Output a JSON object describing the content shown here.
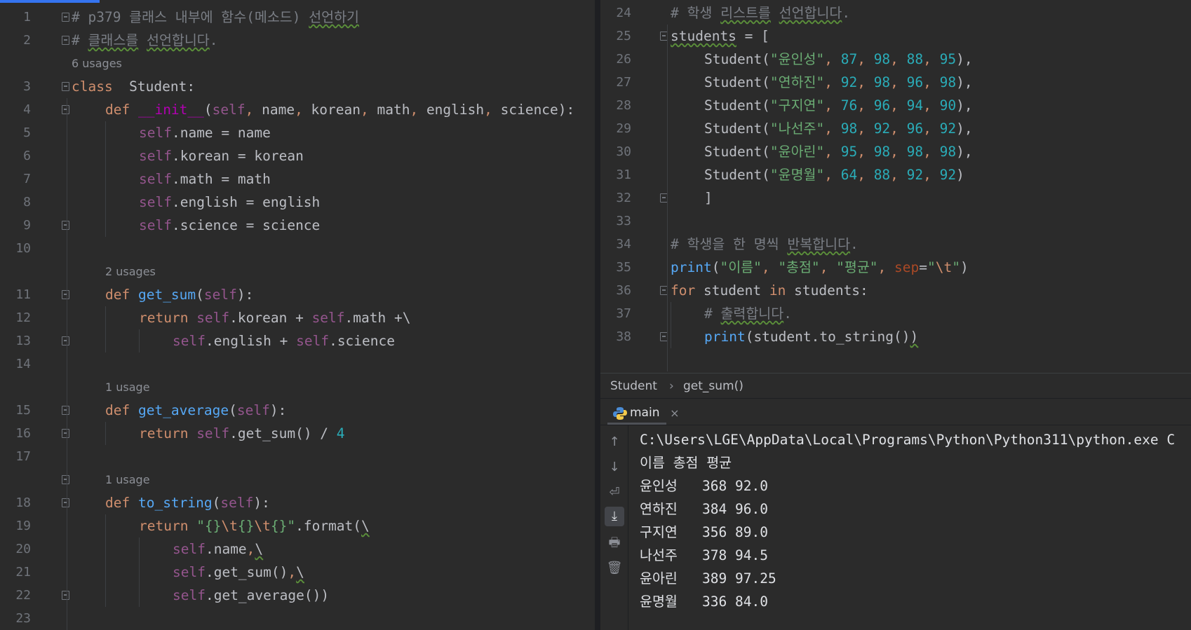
{
  "left_editor": {
    "lines": [
      {
        "n": "1",
        "indent": 0,
        "parts": [
          [
            "cm",
            "# p379 "
          ],
          [
            "cm",
            "클래스 내부에 함수(메소드) "
          ],
          [
            "cm ul",
            "선언하기"
          ]
        ]
      },
      {
        "n": "2",
        "indent": 0,
        "parts": [
          [
            "cm",
            "# "
          ],
          [
            "cm ul",
            "클래스를"
          ],
          [
            "cm",
            " "
          ],
          [
            "cm ul",
            "선언합니다"
          ],
          [
            "cm",
            "."
          ]
        ]
      },
      {
        "usage": "6 usages",
        "indent": 0
      },
      {
        "n": "3",
        "indent": 0,
        "parts": [
          [
            "kw",
            "class"
          ],
          [
            "",
            "  Student:"
          ]
        ]
      },
      {
        "n": "4",
        "indent": 1,
        "parts": [
          [
            "kw",
            "def "
          ],
          [
            "magic",
            "__init__"
          ],
          [
            "",
            "("
          ],
          [
            "self",
            "self"
          ],
          [
            "kw",
            ", "
          ],
          [
            "",
            "name"
          ],
          [
            "kw",
            ", "
          ],
          [
            "",
            "korean"
          ],
          [
            "kw",
            ", "
          ],
          [
            "",
            "math"
          ],
          [
            "kw",
            ", "
          ],
          [
            "",
            "english"
          ],
          [
            "kw",
            ", "
          ],
          [
            "",
            "science):"
          ]
        ]
      },
      {
        "n": "5",
        "indent": 2,
        "parts": [
          [
            "self",
            "self"
          ],
          [
            "",
            ".name = name"
          ]
        ]
      },
      {
        "n": "6",
        "indent": 2,
        "parts": [
          [
            "self",
            "self"
          ],
          [
            "",
            ".korean = korean"
          ]
        ]
      },
      {
        "n": "7",
        "indent": 2,
        "parts": [
          [
            "self",
            "self"
          ],
          [
            "",
            ".math = math"
          ]
        ]
      },
      {
        "n": "8",
        "indent": 2,
        "parts": [
          [
            "self",
            "self"
          ],
          [
            "",
            ".english = english"
          ]
        ]
      },
      {
        "n": "9",
        "indent": 2,
        "parts": [
          [
            "self",
            "self"
          ],
          [
            "",
            ".science = science"
          ]
        ]
      },
      {
        "n": "10",
        "indent": 0,
        "parts": []
      },
      {
        "usage": "2 usages",
        "indent": 1
      },
      {
        "n": "11",
        "indent": 1,
        "parts": [
          [
            "kw",
            "def "
          ],
          [
            "def",
            "get_sum"
          ],
          [
            "",
            "("
          ],
          [
            "self",
            "self"
          ],
          [
            "",
            "):"
          ]
        ]
      },
      {
        "n": "12",
        "indent": 2,
        "parts": [
          [
            "kw",
            "return "
          ],
          [
            "self",
            "self"
          ],
          [
            "",
            ".korean + "
          ],
          [
            "self",
            "self"
          ],
          [
            "",
            ".math +\\"
          ]
        ]
      },
      {
        "n": "13",
        "indent": 3,
        "parts": [
          [
            "self",
            "self"
          ],
          [
            "",
            ".english + "
          ],
          [
            "self",
            "self"
          ],
          [
            "",
            ".science"
          ]
        ]
      },
      {
        "n": "14",
        "indent": 0,
        "parts": []
      },
      {
        "usage": "1 usage",
        "indent": 1
      },
      {
        "n": "15",
        "indent": 1,
        "parts": [
          [
            "kw",
            "def "
          ],
          [
            "def",
            "get_average"
          ],
          [
            "",
            "("
          ],
          [
            "self",
            "self"
          ],
          [
            "",
            "):"
          ]
        ]
      },
      {
        "n": "16",
        "indent": 2,
        "parts": [
          [
            "kw",
            "return "
          ],
          [
            "self",
            "self"
          ],
          [
            "",
            ".get_sum() / "
          ],
          [
            "num",
            "4"
          ]
        ]
      },
      {
        "n": "17",
        "indent": 0,
        "parts": []
      },
      {
        "usage": "1 usage",
        "indent": 1
      },
      {
        "n": "18",
        "indent": 1,
        "parts": [
          [
            "kw",
            "def "
          ],
          [
            "def",
            "to_string"
          ],
          [
            "",
            "("
          ],
          [
            "self",
            "self"
          ],
          [
            "",
            "):"
          ]
        ]
      },
      {
        "n": "19",
        "indent": 2,
        "parts": [
          [
            "kw",
            "return "
          ],
          [
            "str",
            "\"{}"
          ],
          [
            "esc",
            "\\t"
          ],
          [
            "str",
            "{}"
          ],
          [
            "esc",
            "\\t"
          ],
          [
            "str",
            "{}\""
          ],
          [
            "",
            ".format("
          ],
          [
            "ul",
            "\\"
          ]
        ]
      },
      {
        "n": "20",
        "indent": 3,
        "parts": [
          [
            "self",
            "self"
          ],
          [
            "",
            ".name"
          ],
          [
            "kw",
            ","
          ],
          [
            "ul",
            "\\"
          ]
        ]
      },
      {
        "n": "21",
        "indent": 3,
        "parts": [
          [
            "self",
            "self"
          ],
          [
            "",
            ".get_sum()"
          ],
          [
            "kw",
            ","
          ],
          [
            "ul",
            "\\"
          ]
        ]
      },
      {
        "n": "22",
        "indent": 3,
        "parts": [
          [
            "self",
            "self"
          ],
          [
            "",
            ".get_average())"
          ]
        ]
      },
      {
        "n": "23",
        "indent": 0,
        "parts": []
      }
    ]
  },
  "right_editor": {
    "lines": [
      {
        "n": "24",
        "indent": 0,
        "parts": [
          [
            "cm",
            "# 학생 "
          ],
          [
            "cm ul",
            "리스트를"
          ],
          [
            "cm",
            " "
          ],
          [
            "cm ul",
            "선언합니다"
          ],
          [
            "cm",
            "."
          ]
        ]
      },
      {
        "n": "25",
        "indent": 0,
        "parts": [
          [
            "ul",
            "students"
          ],
          [
            "",
            " = ["
          ]
        ]
      },
      {
        "n": "26",
        "indent": 1,
        "parts": [
          [
            "",
            "Student("
          ],
          [
            "str",
            "\"윤인성\""
          ],
          [
            "kw",
            ", "
          ],
          [
            "num",
            "87"
          ],
          [
            "kw",
            ", "
          ],
          [
            "num",
            "98"
          ],
          [
            "kw",
            ", "
          ],
          [
            "num",
            "88"
          ],
          [
            "kw",
            ", "
          ],
          [
            "num",
            "95"
          ],
          [
            "",
            "),"
          ]
        ]
      },
      {
        "n": "27",
        "indent": 1,
        "parts": [
          [
            "",
            "Student("
          ],
          [
            "str",
            "\"연하진\""
          ],
          [
            "kw",
            ", "
          ],
          [
            "num",
            "92"
          ],
          [
            "kw",
            ", "
          ],
          [
            "num",
            "98"
          ],
          [
            "kw",
            ", "
          ],
          [
            "num",
            "96"
          ],
          [
            "kw",
            ", "
          ],
          [
            "num",
            "98"
          ],
          [
            "",
            "),"
          ]
        ]
      },
      {
        "n": "28",
        "indent": 1,
        "parts": [
          [
            "",
            "Student("
          ],
          [
            "str",
            "\"구지연\""
          ],
          [
            "kw",
            ", "
          ],
          [
            "num",
            "76"
          ],
          [
            "kw",
            ", "
          ],
          [
            "num",
            "96"
          ],
          [
            "kw",
            ", "
          ],
          [
            "num",
            "94"
          ],
          [
            "kw",
            ", "
          ],
          [
            "num",
            "90"
          ],
          [
            "",
            "),"
          ]
        ]
      },
      {
        "n": "29",
        "indent": 1,
        "parts": [
          [
            "",
            "Student("
          ],
          [
            "str",
            "\"나선주\""
          ],
          [
            "kw",
            ", "
          ],
          [
            "num",
            "98"
          ],
          [
            "kw",
            ", "
          ],
          [
            "num",
            "92"
          ],
          [
            "kw",
            ", "
          ],
          [
            "num",
            "96"
          ],
          [
            "kw",
            ", "
          ],
          [
            "num",
            "92"
          ],
          [
            "",
            "),"
          ]
        ]
      },
      {
        "n": "30",
        "indent": 1,
        "parts": [
          [
            "",
            "Student("
          ],
          [
            "str",
            "\"윤아린\""
          ],
          [
            "kw",
            ", "
          ],
          [
            "num",
            "95"
          ],
          [
            "kw",
            ", "
          ],
          [
            "num",
            "98"
          ],
          [
            "kw",
            ", "
          ],
          [
            "num",
            "98"
          ],
          [
            "kw",
            ", "
          ],
          [
            "num",
            "98"
          ],
          [
            "",
            "),"
          ]
        ]
      },
      {
        "n": "31",
        "indent": 1,
        "parts": [
          [
            "",
            "Student("
          ],
          [
            "str",
            "\"윤명월\""
          ],
          [
            "kw",
            ", "
          ],
          [
            "num",
            "64"
          ],
          [
            "kw",
            ", "
          ],
          [
            "num",
            "88"
          ],
          [
            "kw",
            ", "
          ],
          [
            "num",
            "92"
          ],
          [
            "kw",
            ", "
          ],
          [
            "num",
            "92"
          ],
          [
            "",
            ")"
          ]
        ]
      },
      {
        "n": "32",
        "indent": 1,
        "parts": [
          [
            "",
            "]"
          ]
        ]
      },
      {
        "n": "33",
        "indent": 0,
        "parts": []
      },
      {
        "n": "34",
        "indent": 0,
        "parts": [
          [
            "cm",
            "# 학생을 한 명씩 "
          ],
          [
            "cm ul",
            "반복합니다"
          ],
          [
            "cm",
            "."
          ]
        ]
      },
      {
        "n": "35",
        "indent": 0,
        "parts": [
          [
            "fn",
            "print"
          ],
          [
            "",
            "("
          ],
          [
            "str",
            "\"이름\""
          ],
          [
            "kw",
            ", "
          ],
          [
            "str",
            "\"총점\""
          ],
          [
            "kw",
            ", "
          ],
          [
            "str",
            "\"평균\""
          ],
          [
            "kw",
            ", "
          ],
          [
            "param",
            "sep"
          ],
          [
            "",
            "="
          ],
          [
            "str",
            "\""
          ],
          [
            "esc",
            "\\t"
          ],
          [
            "str",
            "\""
          ],
          [
            "",
            ")"
          ]
        ]
      },
      {
        "n": "36",
        "indent": 0,
        "parts": [
          [
            "kw",
            "for "
          ],
          [
            "",
            "student "
          ],
          [
            "kw",
            "in "
          ],
          [
            "",
            "students:"
          ]
        ]
      },
      {
        "n": "37",
        "indent": 1,
        "parts": [
          [
            "cm",
            "# "
          ],
          [
            "cm ul",
            "출력합니다"
          ],
          [
            "cm",
            "."
          ]
        ]
      },
      {
        "n": "38",
        "indent": 1,
        "parts": [
          [
            "fn",
            "print"
          ],
          [
            "",
            "(student.to_string()"
          ],
          [
            "ul",
            ")"
          ]
        ]
      }
    ]
  },
  "breadcrumb": {
    "item1": "Student",
    "sep": "›",
    "item2": "get_sum()"
  },
  "run_panel": {
    "tab_label": "main",
    "close": "×",
    "toolbar": [
      "↑",
      "↓",
      "⏎",
      "⤓",
      "🖶",
      "🗑"
    ],
    "console": [
      "C:\\Users\\LGE\\AppData\\Local\\Programs\\Python\\Python311\\python.exe C",
      "이름 총점 평균",
      "윤인성   368 92.0",
      "연하진   384 96.0",
      "구지연   356 89.0",
      "나선주   378 94.5",
      "윤아린   389 97.25",
      "윤명월   336 84.0"
    ]
  }
}
